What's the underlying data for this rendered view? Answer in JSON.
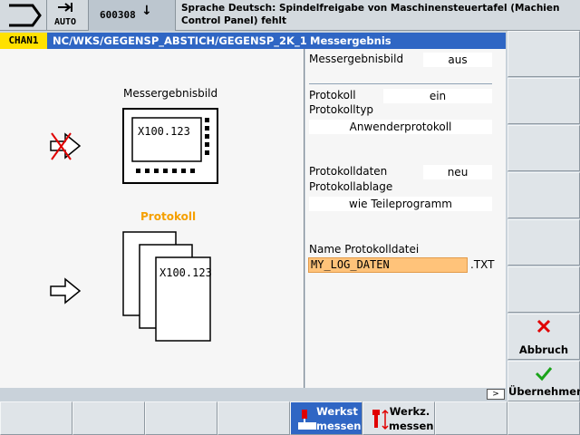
{
  "topbar": {
    "mode_label": "AUTO",
    "program_number": "600308",
    "alarm_text": "Sprache Deutsch: Spindelfreigabe von Maschinensteuertafel (Machien Control Panel) fehlt"
  },
  "channel": {
    "name": "CHAN1",
    "path": "NC/WKS/GEGENSP_ABSTICH/GEGENSP_2K_1",
    "title": "Messergebnis"
  },
  "diagram": {
    "messergebnisbild_caption": "Messergebnisbild",
    "protokoll_caption": "Protokoll",
    "screen_value": "X100.123",
    "paper_value": "X100.123"
  },
  "form": {
    "messergebnisbild_label": "Messergebnisbild",
    "messergebnisbild_value": "aus",
    "protokoll_label": "Protokoll",
    "protokoll_value": "ein",
    "protokolltyp_label": "Protokolltyp",
    "protokolltyp_value": "Anwenderprotokoll",
    "protokolldaten_label": "Protokolldaten",
    "protokolldaten_value": "neu",
    "protokollablage_label": "Protokollablage",
    "protokollablage_value": "wie Teileprogramm",
    "dateiname_label": "Name Protokolldatei",
    "dateiname_value": "MY_LOG_DATEN",
    "dateiname_ext": ".TXT"
  },
  "vertical_softkeys": {
    "abbruch": "Abbruch",
    "uebernehmen": "Übernehmen"
  },
  "horizontal_softkeys": {
    "werkst_messen_1": "Werkst",
    "werkst_messen_2": "messen",
    "werkz_messen_1": "Werkz.",
    "werkz_messen_2": "messen"
  },
  "colors": {
    "accent_blue": "#2f66c4",
    "chan_yellow": "#ffe100",
    "protokoll_orange": "#f5a000",
    "abbruch_red": "#e00000",
    "uebernehmen_green": "#1aa31a",
    "input_highlight": "#ffc37a"
  },
  "icons": {
    "mode": "jog-mode-icon",
    "auto": "auto-arrow-icon",
    "program": "down-arrow-icon",
    "abbruch": "cross-icon",
    "uebernehmen": "check-icon",
    "disabled_arrow": "crossed-arrow-icon",
    "enabled_arrow": "arrow-icon"
  }
}
